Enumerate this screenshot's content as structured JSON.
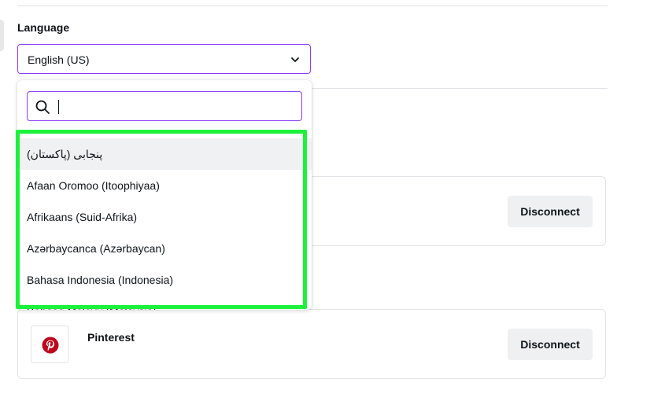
{
  "language": {
    "label": "Language",
    "selected": "English (US)",
    "chevron_icon": "chevron-down-icon"
  },
  "dropdown": {
    "search": {
      "value": "",
      "placeholder": "",
      "icon": "search-icon"
    },
    "options": [
      "پنجابی (پاکستان)",
      "Afaan Oromoo (Itoophiyaa)",
      "Afrikaans (Suid-Afrika)",
      "Azərbaycanca (Azərbaycan)",
      "Bahasa Indonesia (Indonesia)",
      "Bahasa Melayu (Malaysia)"
    ]
  },
  "connections": [
    {
      "name": "",
      "button": "Disconnect"
    },
    {
      "name": "Pinterest",
      "icon": "pinterest-icon",
      "button": "Disconnect"
    }
  ],
  "colors": {
    "accent": "#8b3dff",
    "highlight": "#1cf23c",
    "pinterest": "#bd081c",
    "button_bg": "#eef0f2"
  }
}
